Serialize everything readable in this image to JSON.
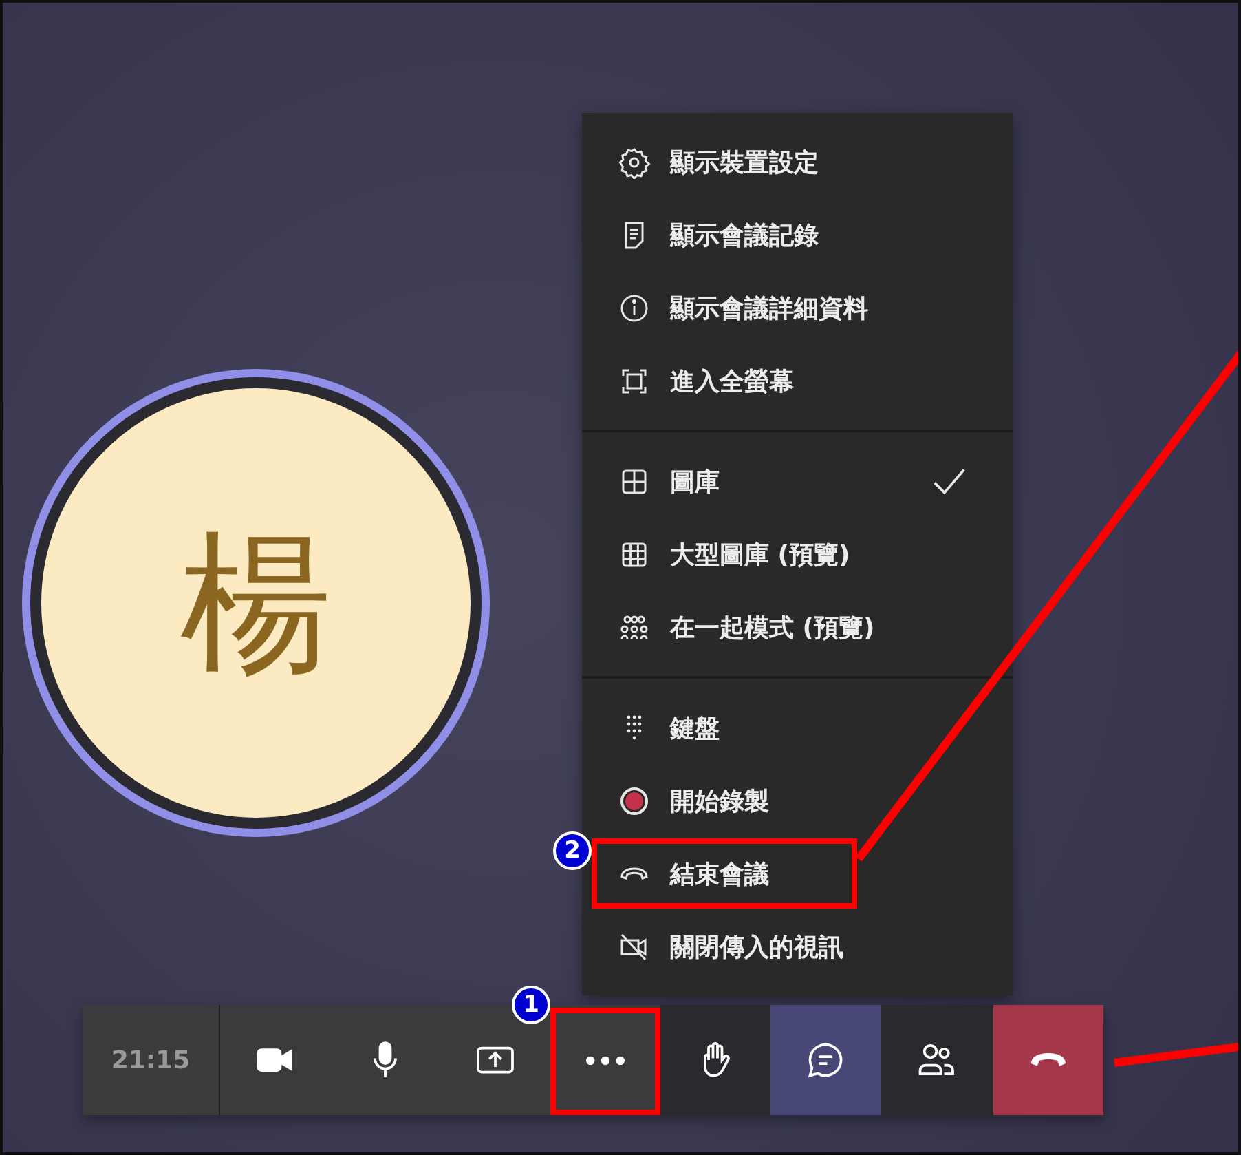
{
  "avatar": {
    "initial": "楊"
  },
  "menu": {
    "groups": [
      {
        "items": [
          {
            "kind": "gear",
            "label": "顯示裝置設定",
            "checked": false
          },
          {
            "kind": "notes",
            "label": "顯示會議記錄",
            "checked": false
          },
          {
            "kind": "info",
            "label": "顯示會議詳細資料",
            "checked": false
          },
          {
            "kind": "fullscreen",
            "label": "進入全螢幕",
            "checked": false
          }
        ]
      },
      {
        "items": [
          {
            "kind": "grid4",
            "label": "圖庫",
            "checked": true
          },
          {
            "kind": "grid9",
            "label": "大型圖庫 (預覽)",
            "checked": false
          },
          {
            "kind": "people",
            "label": "在一起模式 (預覽)",
            "checked": false
          }
        ]
      },
      {
        "items": [
          {
            "kind": "dialpad",
            "label": "鍵盤",
            "checked": false
          },
          {
            "kind": "record",
            "label": "開始錄製",
            "checked": false
          },
          {
            "kind": "hangup",
            "label": "結束會議",
            "checked": false,
            "callout": "2"
          },
          {
            "kind": "videooff",
            "label": "關閉傳入的視訊",
            "checked": false
          }
        ]
      }
    ]
  },
  "toolbar": {
    "time": "21:15",
    "buttons": [
      {
        "kind": "camera",
        "selected": false
      },
      {
        "kind": "mic",
        "selected": false
      },
      {
        "kind": "share",
        "selected": false
      },
      {
        "kind": "more",
        "selected": false,
        "callout": "1"
      },
      {
        "kind": "hand",
        "selected": false
      },
      {
        "kind": "chat",
        "selected": true
      },
      {
        "kind": "participants",
        "selected": false
      },
      {
        "kind": "endcall",
        "selected": false
      }
    ]
  }
}
